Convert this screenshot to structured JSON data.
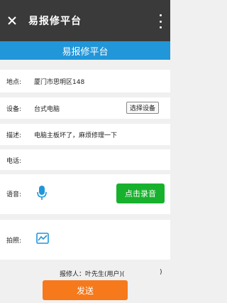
{
  "topbar": {
    "title": "易报修平台",
    "close_icon": "close-icon",
    "more_icon": "more-vertical-icon"
  },
  "header": {
    "title": "易报修平台"
  },
  "form": {
    "location_label": "地点:",
    "location_value": "厦门市思明区148",
    "device_label": "设备:",
    "device_value": "台式电脑",
    "select_device_label": "选择设备",
    "description_label": "描述:",
    "description_value": "电脑主板坏了，麻烦修理一下",
    "phone_label": "电话:",
    "phone_value": "",
    "voice_label": "语音:",
    "voice_icon": "microphone-icon",
    "record_label": "点击录音",
    "photo_label": "拍照:",
    "photo_icon": "image-icon"
  },
  "reporter": {
    "text": "报修人：叶先生(用户)(",
    "close_paren": ")"
  },
  "send_label": "发送",
  "colors": {
    "topbar": "#3a3a3a",
    "header": "#2196d9",
    "record_button": "#18b12d",
    "send_button": "#f6791b",
    "icon_blue": "#2196d9"
  }
}
